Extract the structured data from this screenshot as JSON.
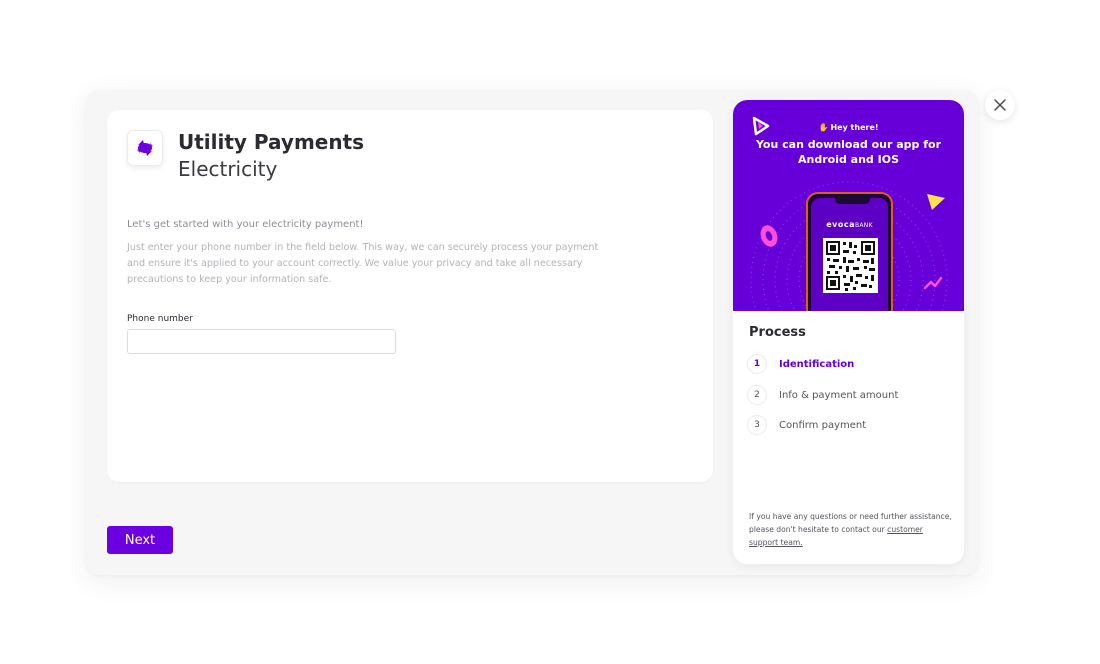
{
  "header": {
    "title": "Utility Payments",
    "subtitle": "Electricity",
    "service_icon": "electricity-icon"
  },
  "intro": {
    "heading": "Let's get started with your electricity payment!",
    "body": "Just enter your phone number in the field below. This way, we can securely process your payment and ensure it's applied to your account correctly. We value your privacy and take all necessary precautions to keep your information safe."
  },
  "form": {
    "phone_label": "Phone number",
    "phone_value": "",
    "phone_placeholder": ""
  },
  "actions": {
    "next_label": "Next",
    "close_icon": "close-icon"
  },
  "promo": {
    "hey": "Hey there!",
    "line": "You can download our app for Android and IOS",
    "brand": "evoca",
    "brand_suffix": "BANK"
  },
  "process": {
    "title": "Process",
    "steps": [
      {
        "num": "1",
        "label": "Identification",
        "active": true
      },
      {
        "num": "2",
        "label": "Info & payment amount",
        "active": false
      },
      {
        "num": "3",
        "label": "Confirm payment",
        "active": false
      }
    ]
  },
  "help": {
    "text": "If you have any questions or need further assistance, please don't hesitate to contact our ",
    "link": "customer support team."
  },
  "colors": {
    "accent": "#6b00e0",
    "banner": "#6700d8",
    "background": "#f6f6f7"
  }
}
